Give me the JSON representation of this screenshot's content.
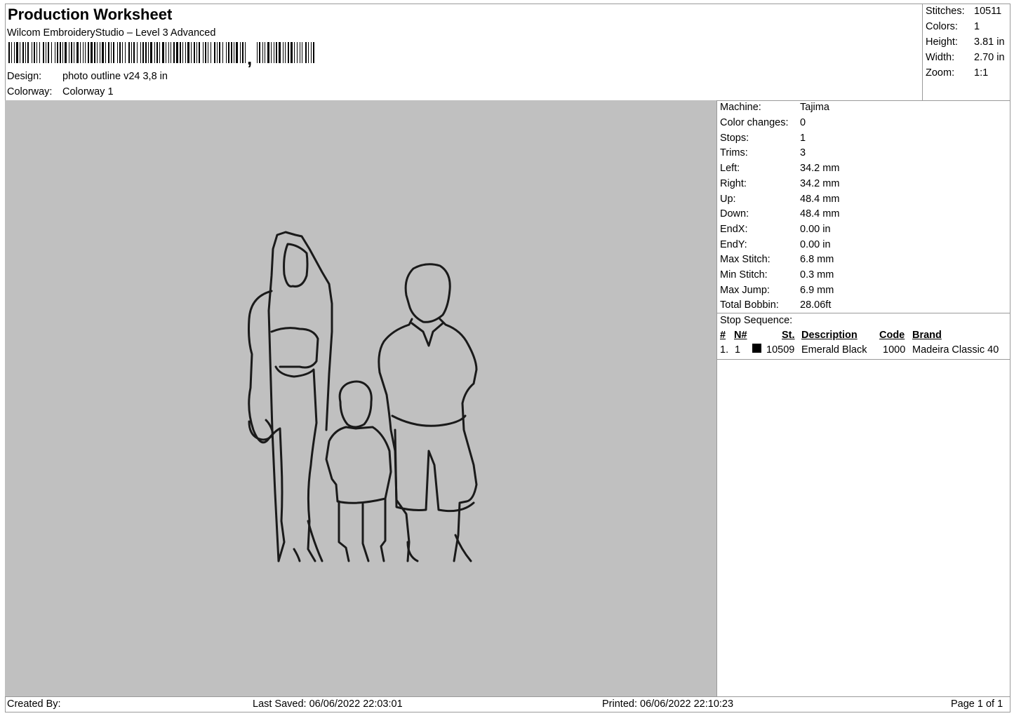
{
  "header": {
    "title": "Production Worksheet",
    "software": "Wilcom EmbroideryStudio – Level 3 Advanced",
    "design_label": "Design:",
    "design_value": "photo outline v24 3,8 in",
    "colorway_label": "Colorway:",
    "colorway_value": "Colorway 1"
  },
  "summary": [
    {
      "label": "Stitches:",
      "value": "10511"
    },
    {
      "label": "Colors:",
      "value": "1"
    },
    {
      "label": "Height:",
      "value": "3.81 in"
    },
    {
      "label": "Width:",
      "value": "2.70 in"
    },
    {
      "label": "Zoom:",
      "value": "1:1"
    }
  ],
  "machine_info": [
    {
      "label": "Machine:",
      "value": "Tajima"
    },
    {
      "label": "Color changes:",
      "value": "0"
    },
    {
      "label": "Stops:",
      "value": "1"
    },
    {
      "label": "Trims:",
      "value": "3"
    },
    {
      "label": "Left:",
      "value": "34.2 mm"
    },
    {
      "label": "Right:",
      "value": "34.2 mm"
    },
    {
      "label": "Up:",
      "value": "48.4 mm"
    },
    {
      "label": "Down:",
      "value": "48.4 mm"
    },
    {
      "label": "EndX:",
      "value": "0.00 in"
    },
    {
      "label": "EndY:",
      "value": "0.00 in"
    },
    {
      "label": "Max Stitch:",
      "value": "6.8 mm"
    },
    {
      "label": "Min Stitch:",
      "value": "0.3 mm"
    },
    {
      "label": "Max Jump:",
      "value": "6.9 mm"
    },
    {
      "label": "Total Bobbin:",
      "value": "28.06ft"
    }
  ],
  "stop_sequence": {
    "title": "Stop Sequence:",
    "headers": {
      "num": "#",
      "n": "N#",
      "st": "St.",
      "description": "Description",
      "code": "Code",
      "brand": "Brand"
    },
    "rows": [
      {
        "num": "1.",
        "n": "1",
        "swatch_color": "#000000",
        "st": "10509",
        "description": "Emerald Black",
        "code": "1000",
        "brand": "Madeira Classic 40"
      }
    ]
  },
  "footer": {
    "created_by": "Created By:",
    "last_saved": "Last Saved: 06/06/2022 22:03:01",
    "printed": "Printed: 06/06/2022 22:10:23",
    "page": "Page 1 of 1"
  },
  "colors": {
    "canvas_bg": "#c0c0c0",
    "stitch": "#1a1a1a",
    "border": "#9a9a9a"
  }
}
